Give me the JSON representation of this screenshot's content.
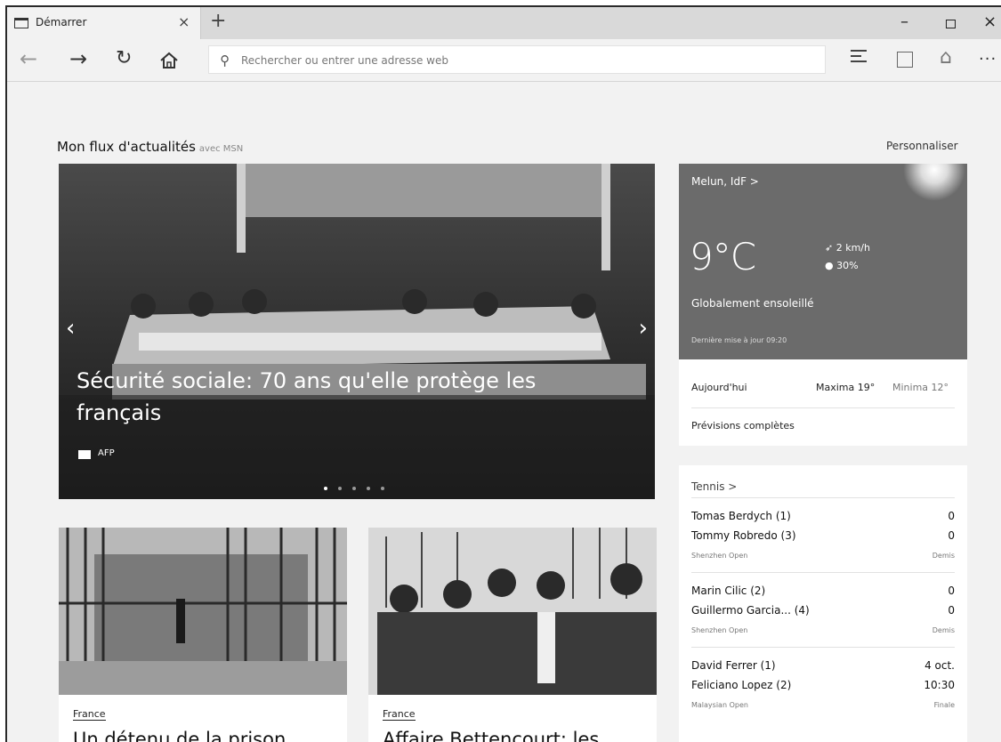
{
  "tab": {
    "title": "Démarrer",
    "close": "×",
    "new": "+"
  },
  "window": {
    "minimize": "–",
    "close": "×"
  },
  "nav": {
    "back": "←",
    "forward": "→",
    "refresh": "↻",
    "address_placeholder": "Rechercher ou entrer une adresse web",
    "more": "···"
  },
  "feed": {
    "title": "Mon flux d'actualités",
    "subtitle": "avec MSN",
    "personalize": "Personnaliser"
  },
  "hero": {
    "title": "Sécurité sociale: 70 ans qu'elle protège les français",
    "source": "AFP",
    "prev": "‹",
    "next": "›",
    "slides": 5,
    "active_slide": 1
  },
  "cards": [
    {
      "category": "France",
      "title": "Un détenu de la prison"
    },
    {
      "category": "France",
      "title": "Affaire Bettencourt: les"
    }
  ],
  "weather": {
    "location": "Melun, IdF >",
    "temperature": "9°C",
    "wind": "2 km/h",
    "rain": "30%",
    "condition": "Globalement ensoleillé",
    "updated": "Dernière mise à jour 09:20",
    "today_label": "Aujourd'hui",
    "max": "Maxima 19°",
    "min": "Minima 12°",
    "full_forecast": "Prévisions complètes"
  },
  "tennis": {
    "title": "Tennis >",
    "matches": [
      {
        "p1": "Tomas Berdych (1)",
        "s1": "0",
        "p2": "Tommy Robredo (3)",
        "s2": "0",
        "tournament": "Shenzhen Open",
        "round": "Demis"
      },
      {
        "p1": "Marin Cilic (2)",
        "s1": "0",
        "p2": "Guillermo Garcia... (4)",
        "s2": "0",
        "tournament": "Shenzhen Open",
        "round": "Demis"
      },
      {
        "p1": "David Ferrer (1)",
        "s1": "4 oct.",
        "p2": "Feliciano Lopez (2)",
        "s2": "10:30",
        "tournament": "Malaysian Open",
        "round": "Finale"
      }
    ]
  }
}
